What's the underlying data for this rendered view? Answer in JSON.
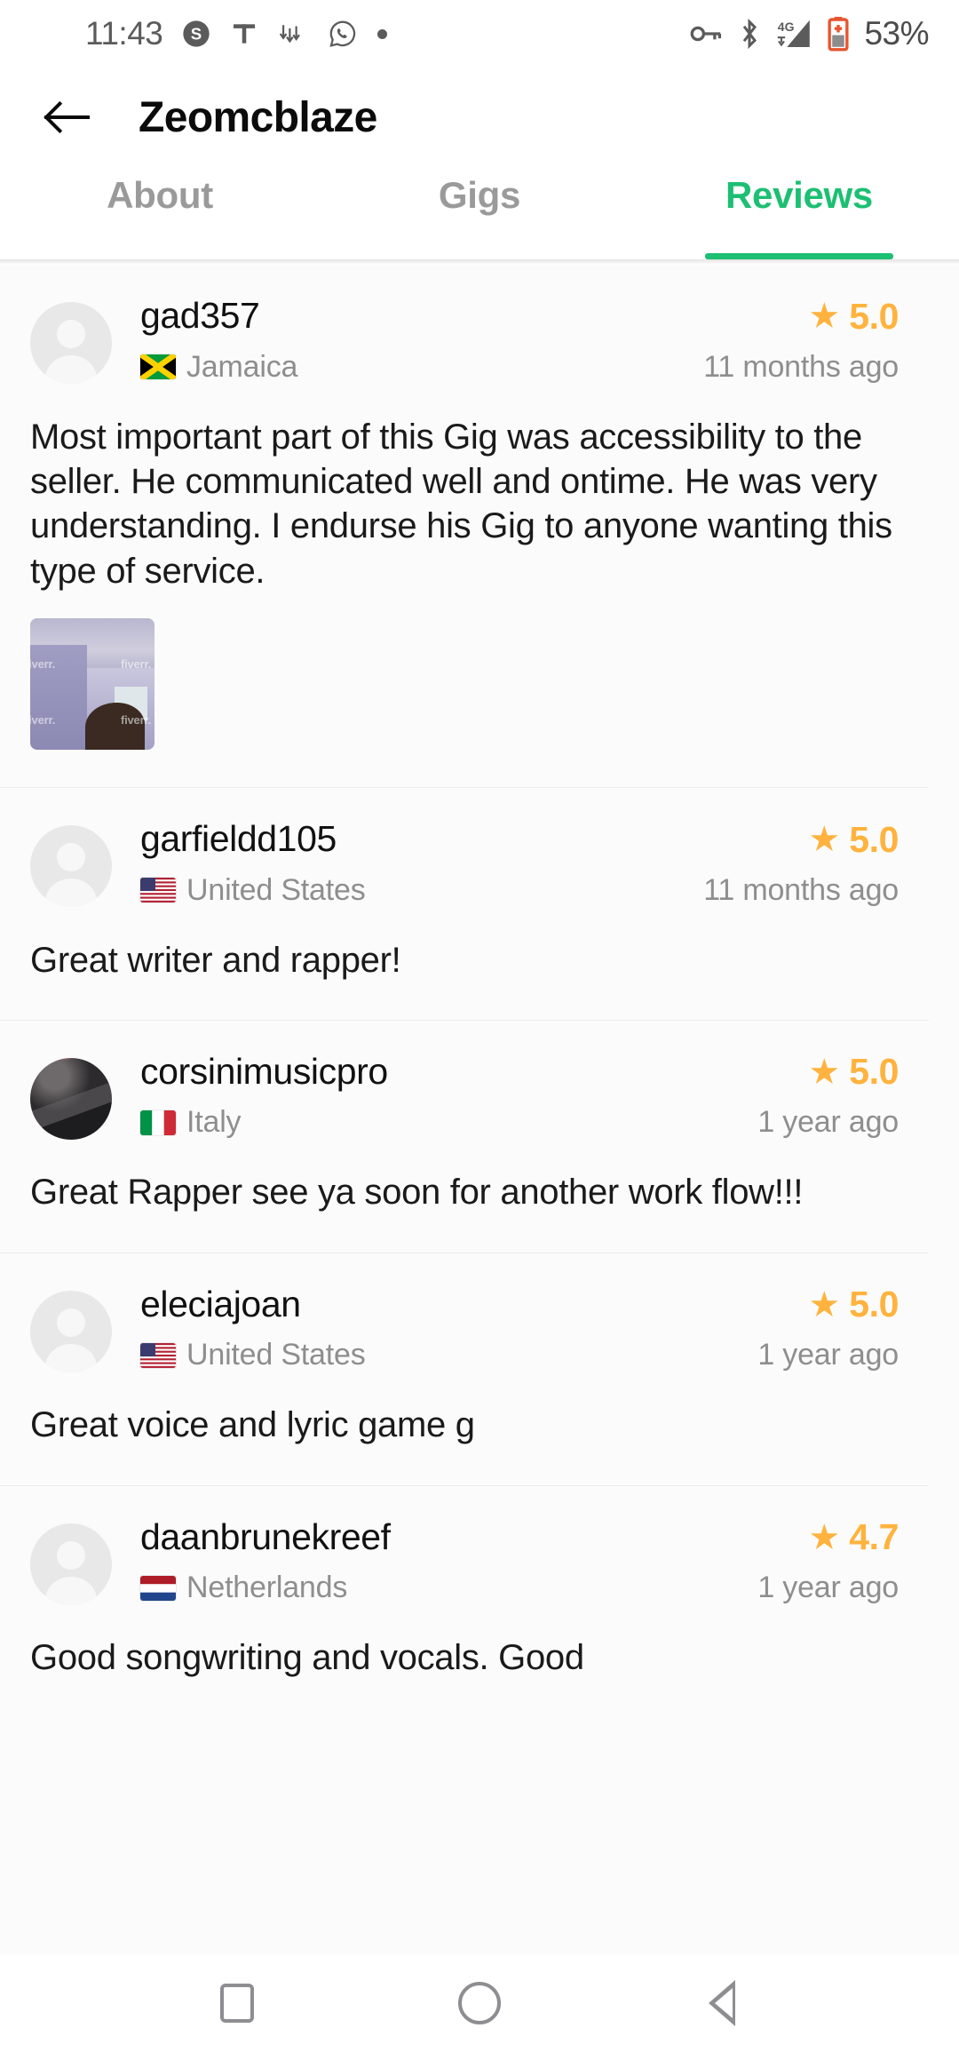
{
  "status_bar": {
    "time": "11:43",
    "battery_percent": "53%",
    "left_icons": [
      "skype-icon",
      "text-icon",
      "data-transfer-icon",
      "whatsapp-icon",
      "dot-icon"
    ],
    "right_icons": [
      "vpn-key-icon",
      "bluetooth-icon",
      "signal-4g-icon",
      "battery-icon"
    ],
    "battery_color": "#e8542f",
    "signal_label": "4G"
  },
  "app_bar": {
    "back_label": "back-arrow",
    "title": "Zeomcblaze"
  },
  "tabs": {
    "items": [
      {
        "label": "About",
        "active": false
      },
      {
        "label": "Gigs",
        "active": false
      },
      {
        "label": "Reviews",
        "active": true
      }
    ],
    "active_color": "#1dbf73",
    "inactive_color": "#9a9a9a"
  },
  "reviews": [
    {
      "username": "gad357",
      "country": "Jamaica",
      "flag": "jamaica-flag",
      "rating": "5.0",
      "time_ago": "11 months ago",
      "text": "Most important part of this Gig was accessibility to the seller. He communicated well and ontime. He was very understanding. I endurse his Gig to anyone wanting this type of service.",
      "avatar": "placeholder",
      "attachments": [
        "review-photo-fiverr-watermark"
      ],
      "watermark": "fiverr."
    },
    {
      "username": "garfieldd105",
      "country": "United States",
      "flag": "united-states-flag",
      "rating": "5.0",
      "time_ago": "11 months ago",
      "text": "Great writer and rapper!",
      "avatar": "placeholder",
      "attachments": []
    },
    {
      "username": "corsinimusicpro",
      "country": "Italy",
      "flag": "italy-flag",
      "rating": "5.0",
      "time_ago": "1 year ago",
      "text": "Great Rapper see ya soon for another work flow!!!",
      "avatar": "photo",
      "attachments": []
    },
    {
      "username": "eleciajoan",
      "country": "United States",
      "flag": "united-states-flag",
      "rating": "5.0",
      "time_ago": "1 year ago",
      "text": "Great voice and lyric game g",
      "avatar": "placeholder",
      "attachments": []
    },
    {
      "username": "daanbrunekreef",
      "country": "Netherlands",
      "flag": "netherlands-flag",
      "rating": "4.7",
      "time_ago": "1 year ago",
      "text": "Good songwriting and vocals. Good",
      "avatar": "placeholder",
      "attachments": []
    }
  ],
  "rating_color": "#ffb33e",
  "nav_bar": {
    "buttons": [
      "recents-square-icon",
      "home-circle-icon",
      "back-triangle-icon"
    ]
  }
}
